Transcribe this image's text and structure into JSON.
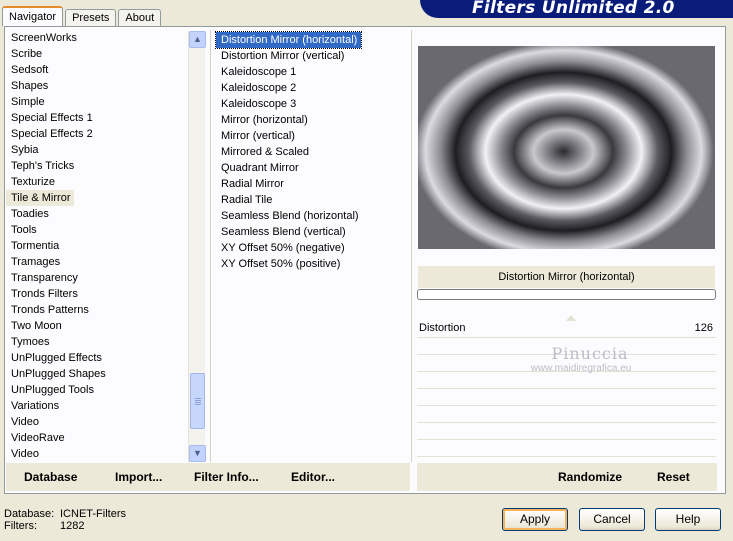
{
  "tabs": [
    "Navigator",
    "Presets",
    "About"
  ],
  "app_title": "Filters Unlimited 2.0",
  "categories": [
    "ScreenWorks",
    "Scribe",
    "Sedsoft",
    "Shapes",
    "Simple",
    "Special Effects 1",
    "Special Effects 2",
    "Sybia",
    "Teph's Tricks",
    "Texturize",
    "Tile & Mirror",
    "Toadies",
    "Tools",
    "Tormentia",
    "Tramages",
    "Transparency",
    "Tronds Filters",
    "Tronds Patterns",
    "Two Moon",
    "Tymoes",
    "UnPlugged Effects",
    "UnPlugged Shapes",
    "UnPlugged Tools",
    "Variations",
    "Video",
    "VideoRave",
    "Video"
  ],
  "selected_category": "Tile & Mirror",
  "filters": [
    "Distortion Mirror (horizontal)",
    "Distortion Mirror (vertical)",
    "Kaleidoscope 1",
    "Kaleidoscope 2",
    "Kaleidoscope 3",
    "Mirror (horizontal)",
    "Mirror (vertical)",
    "Mirrored & Scaled",
    "Quadrant Mirror",
    "Radial Mirror",
    "Radial Tile",
    "Seamless Blend (horizontal)",
    "Seamless Blend (vertical)",
    "XY Offset 50% (negative)",
    "XY Offset 50% (positive)"
  ],
  "selected_filter": "Distortion Mirror (horizontal)",
  "preview_filter_name": "Distortion Mirror (horizontal)",
  "param": {
    "name": "Distortion",
    "value": "126"
  },
  "watermark": {
    "line1": "Pinuccia",
    "line2": "www.maidiregrafica.eu"
  },
  "left_buttons": {
    "database": "Database",
    "import": "Import...",
    "filter_info": "Filter Info...",
    "editor": "Editor..."
  },
  "right_buttons": {
    "randomize": "Randomize",
    "reset": "Reset"
  },
  "status": {
    "database_label": "Database:",
    "database_value": "ICNET-Filters",
    "filters_label": "Filters:",
    "filters_value": "1282"
  },
  "dialog_buttons": {
    "apply": "Apply",
    "cancel": "Cancel",
    "help": "Help"
  },
  "icons": {
    "scroll_up": "▲",
    "scroll_down": "▼"
  }
}
